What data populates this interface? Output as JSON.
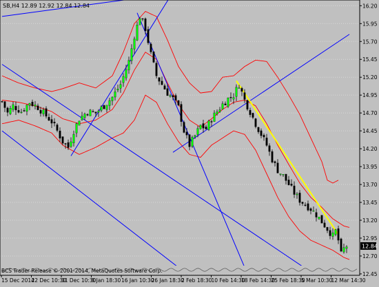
{
  "header": {
    "symbol_line": "SB,H4  12.89 12.92 12.84 12.84"
  },
  "watermark": "BCS Trader Release © 2001-2014, MetaQuotes Software Corp.",
  "price_badge": "12.84",
  "colors": {
    "background": "#c0c0c0",
    "grid": "#d8d8d8",
    "bull_candle": "#00ff00",
    "bear_candle": "#000000",
    "bollinger": "#ff0000",
    "trendlines": "#0000ff",
    "yellow_trendline": "#ffff00"
  },
  "chart_data": {
    "type": "candlestick",
    "timeframe": "H4",
    "y_axis": {
      "ticks": [
        "16.20",
        "15.95",
        "15.70",
        "15.45",
        "15.20",
        "14.95",
        "14.70",
        "14.45",
        "14.20",
        "13.95",
        "13.70",
        "13.45",
        "13.20",
        "12.95",
        "12.70",
        "12.45"
      ],
      "ylim": [
        12.43,
        16.28
      ]
    },
    "x_axis": {
      "ticks": [
        "15 Dec 2014",
        "22 Dec 10:30",
        "31 Dec 10:30",
        "8 Jan 18:30",
        "16 Jan 10:30",
        "26 Jan 18:30",
        "2 Feb 18:30",
        "10 Feb 14:30",
        "18 Feb 14:30",
        "25 Feb 18:30",
        "5 Mar 10:30",
        "12 Mar 14:30"
      ]
    },
    "last_price": 12.84,
    "close_path": [
      [
        0,
        14.86
      ],
      [
        2,
        14.7
      ],
      [
        4,
        14.8
      ],
      [
        7,
        14.72
      ],
      [
        10,
        14.85
      ],
      [
        13,
        14.78
      ],
      [
        16,
        14.66
      ],
      [
        18,
        14.58
      ],
      [
        20,
        14.45
      ],
      [
        22,
        14.3
      ],
      [
        24,
        14.22
      ],
      [
        26,
        14.45
      ],
      [
        28,
        14.62
      ],
      [
        31,
        14.72
      ],
      [
        34,
        14.7
      ],
      [
        37,
        14.8
      ],
      [
        40,
        14.92
      ],
      [
        43,
        15.1
      ],
      [
        46,
        15.42
      ],
      [
        48,
        15.78
      ],
      [
        50,
        16.05
      ],
      [
        52,
        15.88
      ],
      [
        54,
        15.52
      ],
      [
        56,
        15.22
      ],
      [
        58,
        15.1
      ],
      [
        60,
        14.98
      ],
      [
        62,
        14.9
      ],
      [
        64,
        14.78
      ],
      [
        66,
        14.45
      ],
      [
        68,
        14.25
      ],
      [
        70,
        14.38
      ],
      [
        72,
        14.52
      ],
      [
        74,
        14.48
      ],
      [
        76,
        14.62
      ],
      [
        78,
        14.72
      ],
      [
        80,
        14.82
      ],
      [
        82,
        14.9
      ],
      [
        84,
        14.95
      ],
      [
        86,
        15.1
      ],
      [
        88,
        14.88
      ],
      [
        90,
        14.72
      ],
      [
        92,
        14.55
      ],
      [
        94,
        14.4
      ],
      [
        96,
        14.25
      ],
      [
        98,
        14.05
      ],
      [
        100,
        13.9
      ],
      [
        102,
        13.82
      ],
      [
        104,
        13.7
      ],
      [
        106,
        13.58
      ],
      [
        108,
        13.48
      ],
      [
        110,
        13.42
      ],
      [
        112,
        13.36
      ],
      [
        114,
        13.28
      ],
      [
        116,
        13.18
      ],
      [
        118,
        13.08
      ],
      [
        120,
        12.98
      ],
      [
        121,
        13.05
      ],
      [
        122,
        12.92
      ],
      [
        123,
        12.72
      ],
      [
        124,
        12.8
      ],
      [
        125,
        12.84
      ]
    ],
    "bollinger": {
      "upper": [
        [
          0,
          15.22
        ],
        [
          6,
          15.12
        ],
        [
          12,
          15.05
        ],
        [
          18,
          15.0
        ],
        [
          22,
          15.04
        ],
        [
          28,
          15.12
        ],
        [
          34,
          15.05
        ],
        [
          40,
          15.22
        ],
        [
          44,
          15.55
        ],
        [
          48,
          15.95
        ],
        [
          52,
          16.12
        ],
        [
          56,
          16.05
        ],
        [
          60,
          15.72
        ],
        [
          64,
          15.35
        ],
        [
          68,
          15.12
        ],
        [
          72,
          14.98
        ],
        [
          76,
          15.0
        ],
        [
          80,
          15.2
        ],
        [
          84,
          15.22
        ],
        [
          88,
          15.35
        ],
        [
          92,
          15.44
        ],
        [
          96,
          15.42
        ],
        [
          100,
          15.2
        ],
        [
          104,
          14.95
        ],
        [
          108,
          14.68
        ],
        [
          112,
          14.35
        ],
        [
          116,
          14.02
        ],
        [
          118,
          13.76
        ],
        [
          120,
          13.72
        ],
        [
          122,
          13.76
        ]
      ],
      "middle": [
        [
          0,
          14.88
        ],
        [
          6,
          14.85
        ],
        [
          12,
          14.8
        ],
        [
          18,
          14.72
        ],
        [
          22,
          14.62
        ],
        [
          28,
          14.55
        ],
        [
          34,
          14.6
        ],
        [
          40,
          14.75
        ],
        [
          44,
          14.98
        ],
        [
          48,
          15.3
        ],
        [
          52,
          15.55
        ],
        [
          56,
          15.45
        ],
        [
          60,
          15.12
        ],
        [
          64,
          14.82
        ],
        [
          68,
          14.6
        ],
        [
          72,
          14.5
        ],
        [
          76,
          14.62
        ],
        [
          80,
          14.75
        ],
        [
          84,
          14.85
        ],
        [
          88,
          14.88
        ],
        [
          92,
          14.8
        ],
        [
          96,
          14.55
        ],
        [
          100,
          14.25
        ],
        [
          104,
          13.98
        ],
        [
          108,
          13.72
        ],
        [
          112,
          13.52
        ],
        [
          116,
          13.38
        ],
        [
          120,
          13.22
        ],
        [
          124,
          13.12
        ],
        [
          126,
          13.1
        ]
      ],
      "lower": [
        [
          0,
          14.55
        ],
        [
          6,
          14.6
        ],
        [
          12,
          14.52
        ],
        [
          18,
          14.42
        ],
        [
          22,
          14.25
        ],
        [
          28,
          14.12
        ],
        [
          34,
          14.22
        ],
        [
          40,
          14.35
        ],
        [
          44,
          14.42
        ],
        [
          48,
          14.6
        ],
        [
          52,
          14.95
        ],
        [
          56,
          14.85
        ],
        [
          60,
          14.55
        ],
        [
          64,
          14.3
        ],
        [
          68,
          14.12
        ],
        [
          72,
          14.08
        ],
        [
          76,
          14.25
        ],
        [
          80,
          14.35
        ],
        [
          84,
          14.45
        ],
        [
          88,
          14.4
        ],
        [
          92,
          14.18
        ],
        [
          96,
          13.85
        ],
        [
          100,
          13.52
        ],
        [
          104,
          13.25
        ],
        [
          108,
          13.05
        ],
        [
          112,
          12.92
        ],
        [
          116,
          12.85
        ],
        [
          120,
          12.78
        ],
        [
          124,
          12.68
        ],
        [
          126,
          12.65
        ]
      ]
    },
    "trendlines": [
      {
        "color": "blue",
        "from": [
          0,
          16.05
        ],
        "to": [
          125,
          16.7
        ]
      },
      {
        "color": "blue",
        "from": [
          0,
          15.38
        ],
        "to": [
          113,
          12.45
        ]
      },
      {
        "color": "blue",
        "from": [
          0,
          14.45
        ],
        "to": [
          67,
          12.45
        ]
      },
      {
        "color": "blue",
        "from": [
          25,
          14.1
        ],
        "to": [
          67,
          16.7
        ]
      },
      {
        "color": "blue",
        "from": [
          49,
          16.1
        ],
        "to": [
          89,
          12.45
        ]
      },
      {
        "color": "blue",
        "from": [
          62,
          14.15
        ],
        "to": [
          126,
          15.8
        ]
      },
      {
        "color": "yellow",
        "from": [
          85,
          15.15
        ],
        "to": [
          122,
          13.0
        ]
      }
    ]
  }
}
